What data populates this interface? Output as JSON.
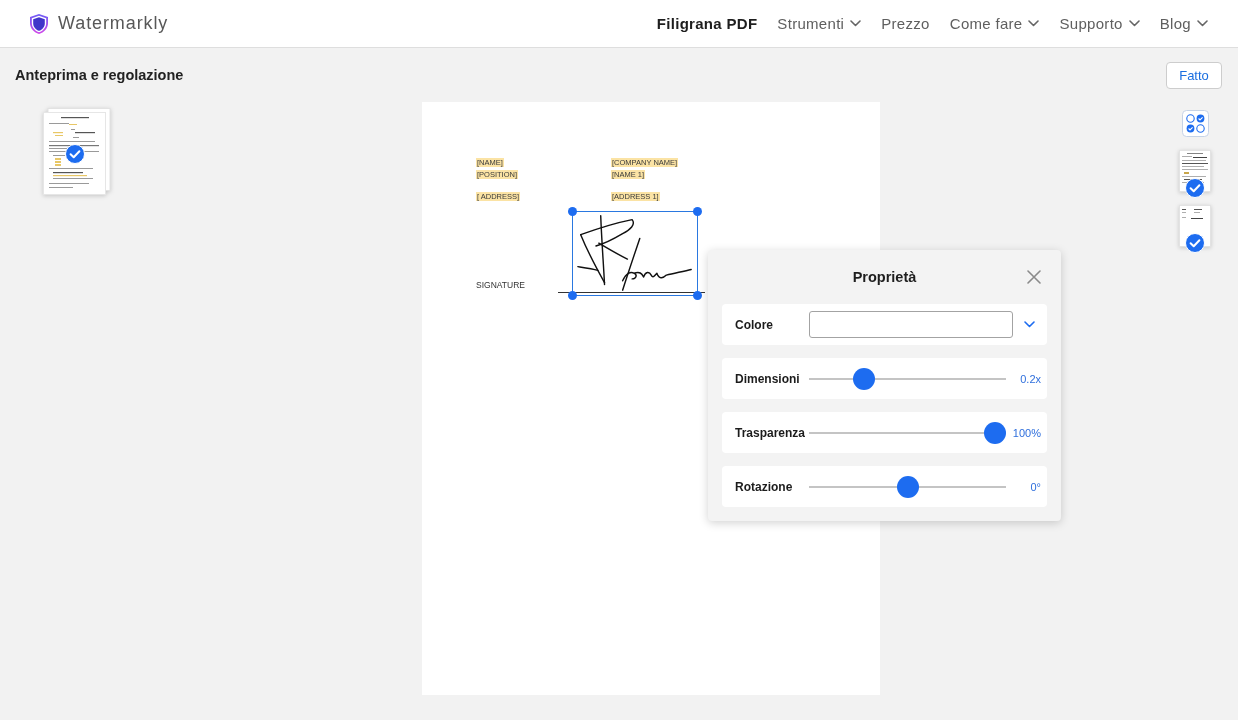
{
  "header": {
    "brand": "Watermarkly",
    "nav": [
      {
        "label": "Filigrana PDF",
        "selected": true,
        "dropdown": false
      },
      {
        "label": "Strumenti",
        "selected": false,
        "dropdown": true
      },
      {
        "label": "Prezzo",
        "selected": false,
        "dropdown": false
      },
      {
        "label": "Come fare",
        "selected": false,
        "dropdown": true
      },
      {
        "label": "Supporto",
        "selected": false,
        "dropdown": true
      },
      {
        "label": "Blog",
        "selected": false,
        "dropdown": true
      }
    ]
  },
  "toolbar": {
    "title": "Anteprima e regolazione",
    "done_button": "Fatto"
  },
  "files": [
    {
      "checked": true
    }
  ],
  "document": {
    "field_groups": [
      [
        {
          "left": "[NAME]",
          "right": "[COMPANY NAME]"
        },
        {
          "left": "[POSITION]",
          "right": "[NAME 1]"
        }
      ],
      [
        {
          "left": "[ ADDRESS]",
          "right": "[ADDRESS 1]"
        }
      ]
    ],
    "signature_label": "SIGNATURE",
    "signature_selected": true
  },
  "pages": [
    {
      "checked": true
    },
    {
      "checked": true
    }
  ],
  "properties": {
    "title": "Proprietà",
    "rows": [
      {
        "kind": "dropdown",
        "label": "Colore"
      },
      {
        "kind": "slider",
        "label": "Dimensioni",
        "level": 0.25,
        "reading": "0.2x"
      },
      {
        "kind": "slider",
        "label": "Trasparenza",
        "level": 1,
        "reading": "100%"
      },
      {
        "kind": "slider",
        "label": "Rotazione",
        "level": 0.5,
        "reading": "0°"
      }
    ]
  }
}
